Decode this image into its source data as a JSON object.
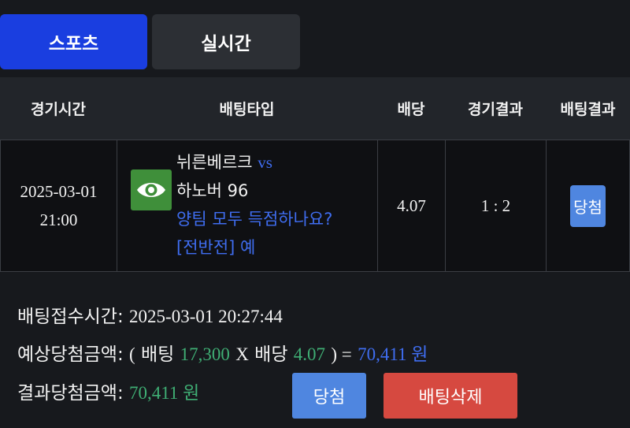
{
  "tabs": [
    {
      "label": "스포츠",
      "active": true
    },
    {
      "label": "실시간",
      "active": false
    }
  ],
  "table": {
    "headers": [
      "경기시간",
      "배팅타입",
      "배당",
      "경기결과",
      "배팅결과"
    ],
    "row": {
      "date": "2025-03-01",
      "time": "21:00",
      "home_team": "뉘른베르크",
      "vs": "vs",
      "away_team": "하노버 96",
      "market": "양팀 모두 득점하나요?",
      "period": "[전반전]",
      "pick": "예",
      "odds": "4.07",
      "score": "1 : 2",
      "result": "당첨"
    }
  },
  "summary": {
    "bet_time_label": "배팅접수시간:",
    "bet_time_value": "2025-03-01 20:27:44",
    "expected_label": "예상당첨금액:",
    "open_paren": "(",
    "bet_word": "배팅",
    "bet_amount": "17,300",
    "times": "X",
    "odds_word": "배당",
    "odds_value": "4.07",
    "close_paren_eq": ") =",
    "expected_amount": "70,411 원",
    "result_label": "결과당첨금액:",
    "result_amount": "70,411 원"
  },
  "buttons": {
    "win": "당첨",
    "delete": "배팅삭제"
  },
  "icons": {
    "bet_type": "eye-icon"
  },
  "colors": {
    "active_tab": "#1a3ee0",
    "inactive_tab": "#2c2f34",
    "win": "#4f86e0",
    "delete": "#d64940",
    "highlight_blue": "#3f6df0",
    "amount_green": "#3fae74",
    "icon_bg": "#3f8f3a"
  }
}
